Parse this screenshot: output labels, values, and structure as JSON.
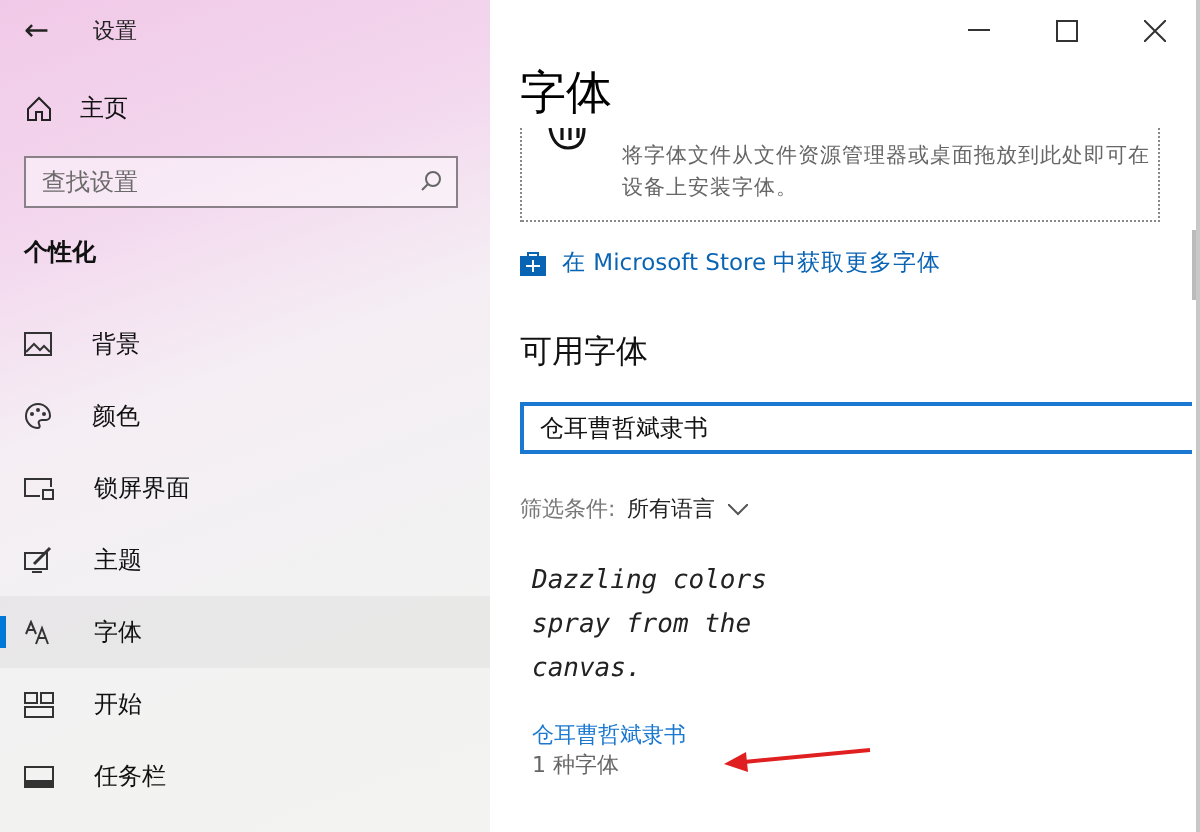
{
  "window": {
    "title": "设置",
    "back_glyph": "←"
  },
  "sidebar": {
    "home": "主页",
    "search": {
      "placeholder": "查找设置"
    },
    "section": "个性化",
    "items": [
      {
        "label": "背景",
        "kind": "background",
        "selected": false
      },
      {
        "label": "颜色",
        "kind": "color",
        "selected": false
      },
      {
        "label": "锁屏界面",
        "kind": "lock",
        "selected": false
      },
      {
        "label": "主题",
        "kind": "theme",
        "selected": false
      },
      {
        "label": "字体",
        "kind": "font",
        "selected": true
      },
      {
        "label": "开始",
        "kind": "start",
        "selected": false
      },
      {
        "label": "任务栏",
        "kind": "taskbar",
        "selected": false
      }
    ]
  },
  "content": {
    "title": "字体",
    "drop_area": {
      "description": "将字体文件从文件资源管理器或桌面拖放到此处即可在设备上安装字体。"
    },
    "store_link": "在 Microsoft Store 中获取更多字体",
    "available_heading": "可用字体",
    "font_search": {
      "value": "仓耳曹哲斌隶书"
    },
    "filter": {
      "label": "筛选条件:",
      "value": "所有语言"
    },
    "results": [
      {
        "sample": "Dazzling colors spray from the canvas.",
        "name": "仓耳曹哲斌隶书",
        "count": "1 种字体"
      }
    ]
  }
}
